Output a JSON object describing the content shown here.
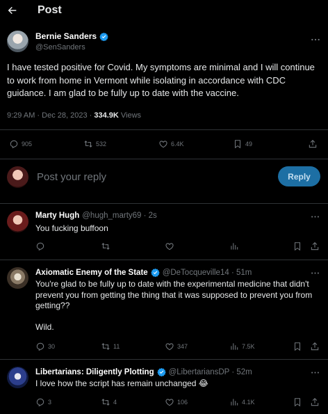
{
  "header": {
    "title": "Post",
    "back_icon": "back-arrow-icon"
  },
  "main_post": {
    "author_name": "Bernie Sanders",
    "author_handle": "@SenSanders",
    "verified": true,
    "text": "I have tested positive for Covid. My symptoms are minimal and I will continue to work from home in Vermont while isolating in accordance with CDC guidance. I am glad to be fully up to date with the vaccine.",
    "time": "9:29 AM · Dec 28, 2023 · ",
    "views_count": "334.9K",
    "views_label": "Views",
    "stats": {
      "replies": "905",
      "reposts": "532",
      "likes": "6.4K",
      "bookmarks": "49"
    }
  },
  "reply_box": {
    "placeholder": "Post your reply",
    "button_label": "Reply"
  },
  "replies": [
    {
      "name": "Marty Hugh",
      "handle": "@hugh_marty69 · 2s",
      "text": "You fucking buffoon",
      "stats": {
        "replies": "",
        "reposts": "",
        "likes": "",
        "views": ""
      }
    },
    {
      "name": "Axiomatic Enemy of the State",
      "handle": "@DeTocqueville14 · 51m",
      "text": "You're glad to be fully up to date with the experimental medicine that didn't prevent you from getting the thing that it was supposed to prevent you from getting??\n\nWild.",
      "stats": {
        "replies": "30",
        "reposts": "11",
        "likes": "347",
        "views": "7.5K"
      }
    },
    {
      "name": "Libertarians: Diligently Plotting",
      "handle": "@LibertariansDP · 52m",
      "text": "I love how the script has remain unchanged 😂",
      "stats": {
        "replies": "3",
        "reposts": "4",
        "likes": "106",
        "views": "4.1K"
      }
    }
  ],
  "colors": {
    "accent": "#1d9bf0",
    "reply_button": "#1d6fa4",
    "divider": "#2f3336",
    "muted": "#71767b"
  }
}
